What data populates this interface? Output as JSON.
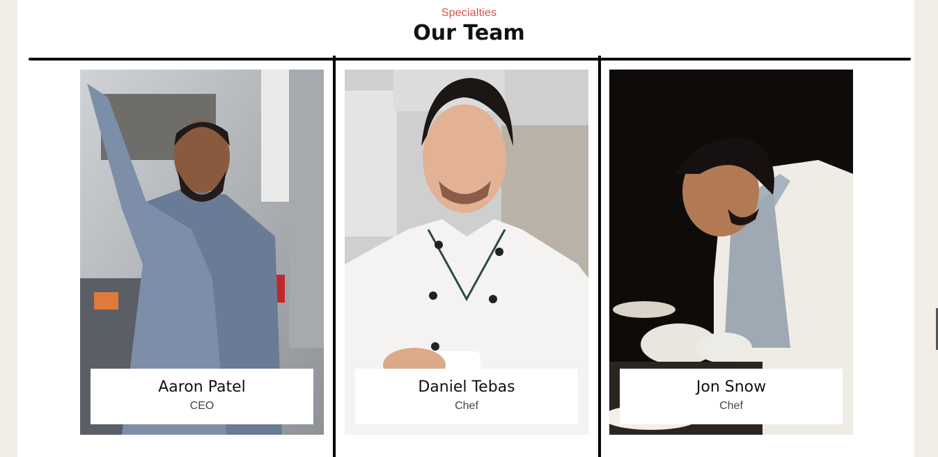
{
  "section": {
    "eyebrow": "Specialties",
    "title": "Our Team"
  },
  "team": [
    {
      "name": "Aaron Patel",
      "role": "CEO",
      "photo": "person-in-kitchen-photo"
    },
    {
      "name": "Daniel Tebas",
      "role": "Chef",
      "photo": "chef-white-jacket-photo"
    },
    {
      "name": "Jon Snow",
      "role": "Chef",
      "photo": "chef-plating-food-photo"
    }
  ],
  "colors": {
    "accent": "#e04b4b",
    "page_background": "#f3ede7",
    "panel_background": "#ffffff",
    "rule": "#000000"
  }
}
